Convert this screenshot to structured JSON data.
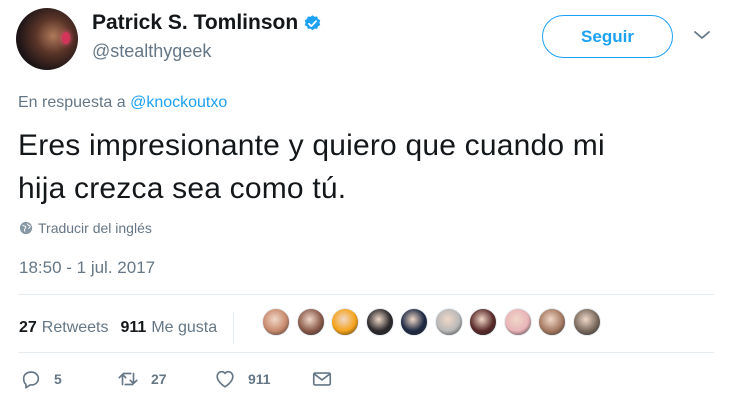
{
  "author": {
    "display_name": "Patrick S. Tomlinson",
    "handle": "@stealthygeek",
    "verified": true
  },
  "follow_button": {
    "label": "Seguir"
  },
  "icons": {
    "verified": "verified-badge-icon",
    "menu": "chevron-down-icon",
    "translate": "globe-icon",
    "reply": "reply-icon",
    "retweet": "retweet-icon",
    "like": "heart-icon",
    "dm": "envelope-icon"
  },
  "reply_context": {
    "prefix": "En respuesta a",
    "mention": "@knockoutxo"
  },
  "tweet": {
    "text_line1": "Eres impresionante y quiero que cuando mi",
    "text_line2": "hija crezca sea como tú."
  },
  "translate": {
    "label": "Traducir del inglés"
  },
  "timestamp": "18:50 - 1 jul. 2017",
  "stats": {
    "retweets_count": "27",
    "retweets_label": "Retweets",
    "likes_count": "911",
    "likes_label": "Me gusta"
  },
  "liker_avatars": [
    {
      "color": "#c98a6e"
    },
    {
      "color": "#8a5a4a"
    },
    {
      "color": "#f5a31a"
    },
    {
      "color": "#2d2a2e"
    },
    {
      "color": "#1f2a44"
    },
    {
      "color": "#b8b8b8"
    },
    {
      "color": "#5a2a2a"
    },
    {
      "color": "#e8b4b8"
    },
    {
      "color": "#a67a62"
    },
    {
      "color": "#7a6a5e"
    }
  ],
  "actions": {
    "reply_count": "5",
    "retweet_count": "27",
    "like_count": "911"
  },
  "colors": {
    "accent": "#1da1f2",
    "text": "#14171a",
    "muted": "#657786",
    "divider": "#e6ecf0"
  }
}
